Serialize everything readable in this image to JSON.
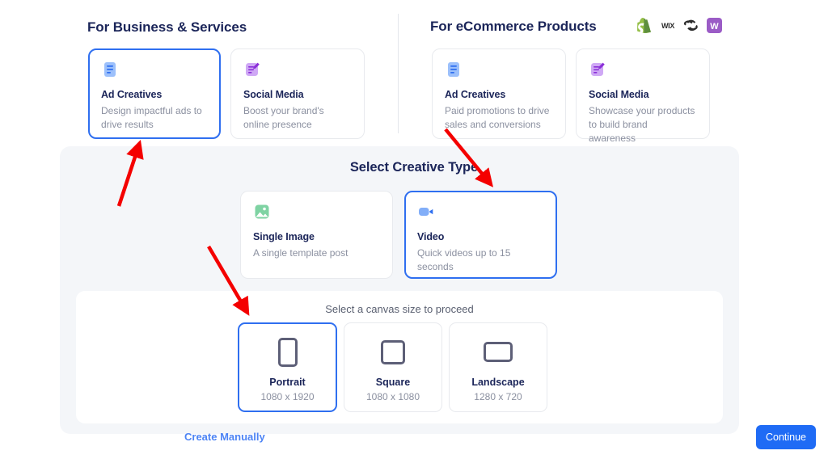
{
  "sections": {
    "business": {
      "title": "For Business & Services",
      "cards": [
        {
          "icon": "document-lines-icon",
          "title": "Ad Creatives",
          "desc": "Design impactful ads to drive results",
          "selected": true
        },
        {
          "icon": "note-pencil-icon",
          "title": "Social Media",
          "desc": "Boost your brand's online presence",
          "selected": false
        }
      ]
    },
    "ecommerce": {
      "title": "For eCommerce Products",
      "platforms": [
        {
          "name": "shopify-icon",
          "label": ""
        },
        {
          "name": "wix-icon",
          "label": "WIX"
        },
        {
          "name": "squarespace-icon",
          "label": ""
        },
        {
          "name": "woocommerce-icon",
          "label": "W"
        }
      ],
      "cards": [
        {
          "icon": "document-lines-icon",
          "title": "Ad Creatives",
          "desc": "Paid promotions to drive sales and conversions",
          "selected": false
        },
        {
          "icon": "note-pencil-icon",
          "title": "Social Media",
          "desc": "Showcase your products to build brand awareness",
          "selected": false
        }
      ]
    }
  },
  "creative_type": {
    "heading": "Select Creative Type",
    "cards": [
      {
        "icon": "image-icon",
        "title": "Single Image",
        "desc": "A single template post",
        "selected": false
      },
      {
        "icon": "video-camera-icon",
        "title": "Video",
        "desc": "Quick videos up to 15 seconds",
        "selected": true
      }
    ]
  },
  "canvas": {
    "heading": "Select a canvas size to proceed",
    "sizes": [
      {
        "shape": "portrait-icon",
        "name": "Portrait",
        "dims": "1080 x 1920",
        "selected": true
      },
      {
        "shape": "square-icon",
        "name": "Square",
        "dims": "1080 x 1080",
        "selected": false
      },
      {
        "shape": "landscape-icon",
        "name": "Landscape",
        "dims": "1280 x 720",
        "selected": false
      }
    ]
  },
  "footer": {
    "create_manually": "Create Manually",
    "continue": "Continue"
  },
  "colors": {
    "accent_blue": "#1f6bf5",
    "selected_border": "#2f6ff0",
    "link_blue": "#4d84f5",
    "heading_navy": "#1b2559",
    "muted_text": "#8b90a0",
    "panel_gray": "#f4f6f9",
    "annotation_red": "#f40000"
  },
  "annotations": {
    "arrow_count": 3,
    "color": "#f40000"
  }
}
